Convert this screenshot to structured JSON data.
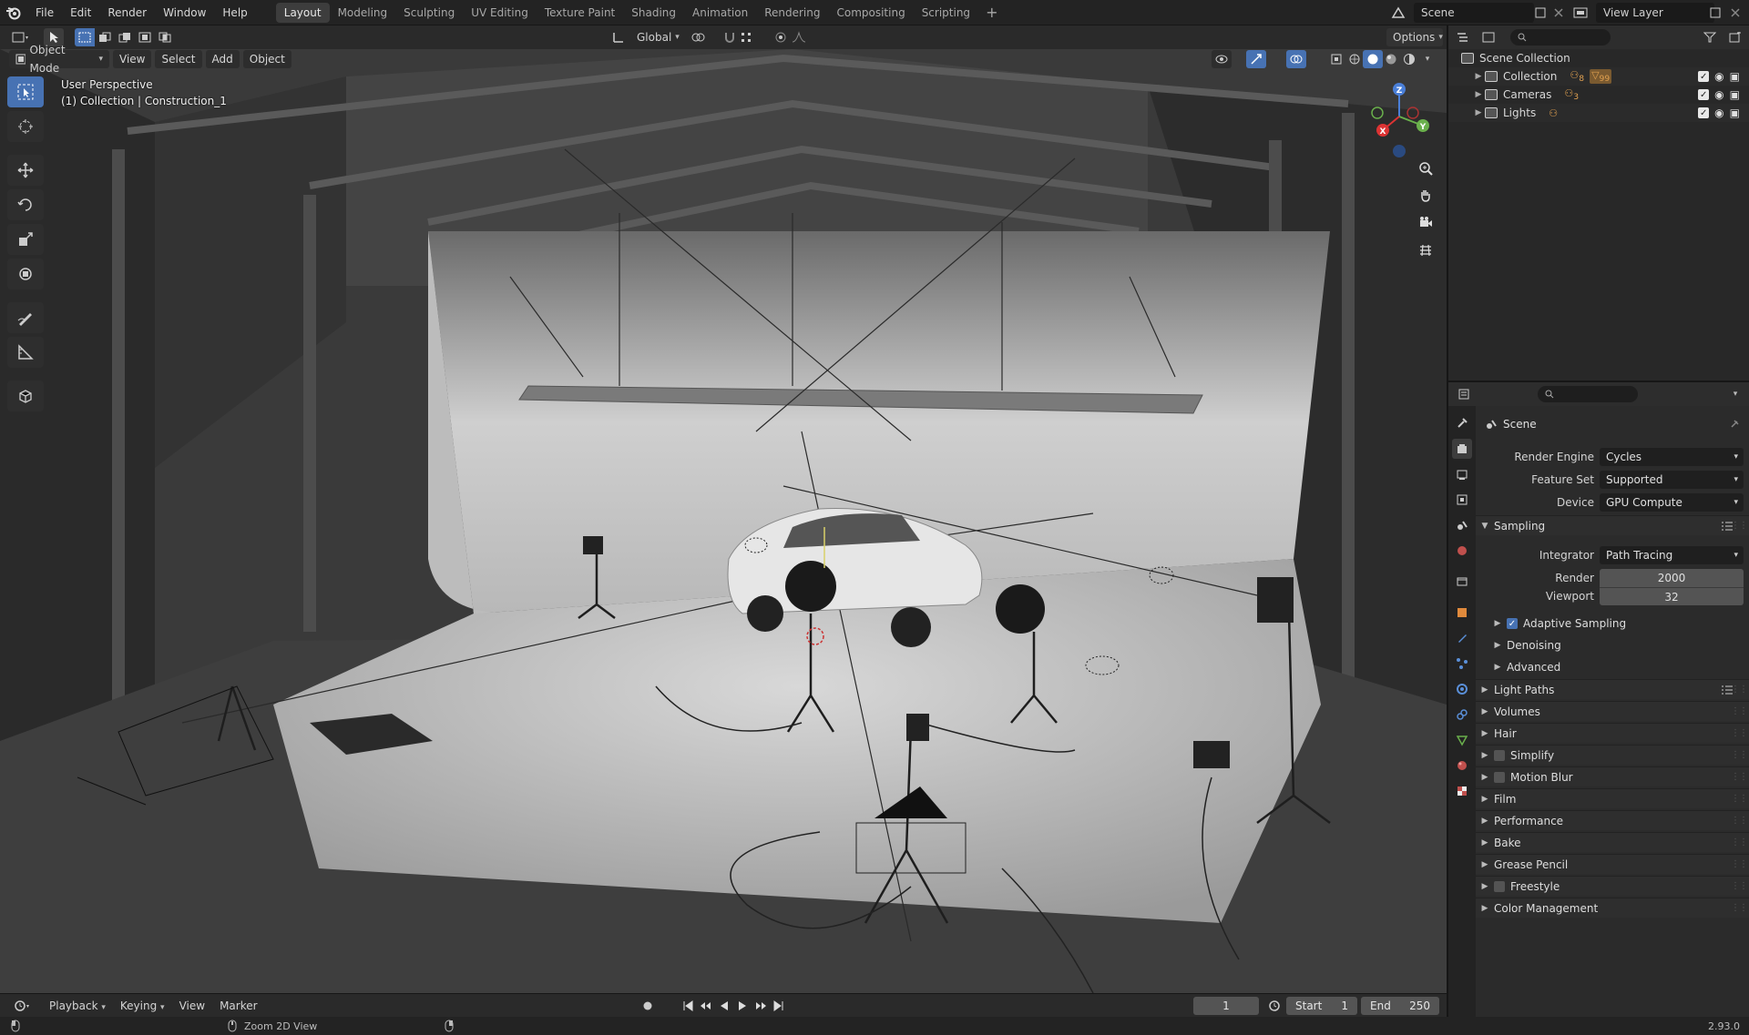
{
  "topbar": {
    "menus": [
      "File",
      "Edit",
      "Render",
      "Window",
      "Help"
    ],
    "workspaces": [
      "Layout",
      "Modeling",
      "Sculpting",
      "UV Editing",
      "Texture Paint",
      "Shading",
      "Animation",
      "Rendering",
      "Compositing",
      "Scripting"
    ],
    "active_workspace": "Layout",
    "add_tab": "+",
    "scene_name": "Scene",
    "view_layer": "View Layer"
  },
  "viewport_header": {
    "transform_orientation": "Global",
    "options_label": "Options"
  },
  "viewport_menu": {
    "mode": "Object Mode",
    "items": [
      "View",
      "Select",
      "Add",
      "Object"
    ]
  },
  "viewport_info": {
    "perspective": "User Perspective",
    "context": "(1) Collection | Construction_1"
  },
  "gizmo": {
    "x": "X",
    "y": "Y",
    "z": "Z"
  },
  "outliner": {
    "root": "Scene Collection",
    "items": [
      {
        "label": "Collection",
        "badge": "8",
        "badge2": "99"
      },
      {
        "label": "Cameras",
        "badge": "3"
      },
      {
        "label": "Lights",
        "badge": ""
      }
    ]
  },
  "properties": {
    "context_title": "Scene",
    "render_engine_label": "Render Engine",
    "render_engine": "Cycles",
    "feature_set_label": "Feature Set",
    "feature_set": "Supported",
    "device_label": "Device",
    "device": "GPU Compute",
    "sampling": {
      "title": "Sampling",
      "integrator_label": "Integrator",
      "integrator": "Path Tracing",
      "render_label": "Render",
      "render_value": "2000",
      "viewport_label": "Viewport",
      "viewport_value": "32",
      "subpanels": [
        "Adaptive Sampling",
        "Denoising",
        "Advanced"
      ]
    },
    "panels": [
      "Light Paths",
      "Volumes",
      "Hair",
      "Simplify",
      "Motion Blur",
      "Film",
      "Performance",
      "Bake",
      "Grease Pencil",
      "Freestyle",
      "Color Management"
    ]
  },
  "timeline": {
    "menus": [
      "Playback",
      "Keying",
      "View",
      "Marker"
    ],
    "current_frame": "1",
    "start_label": "Start",
    "start_value": "1",
    "end_label": "End",
    "end_value": "250"
  },
  "statusbar": {
    "hint": "Zoom 2D View",
    "version": "2.93.0"
  }
}
